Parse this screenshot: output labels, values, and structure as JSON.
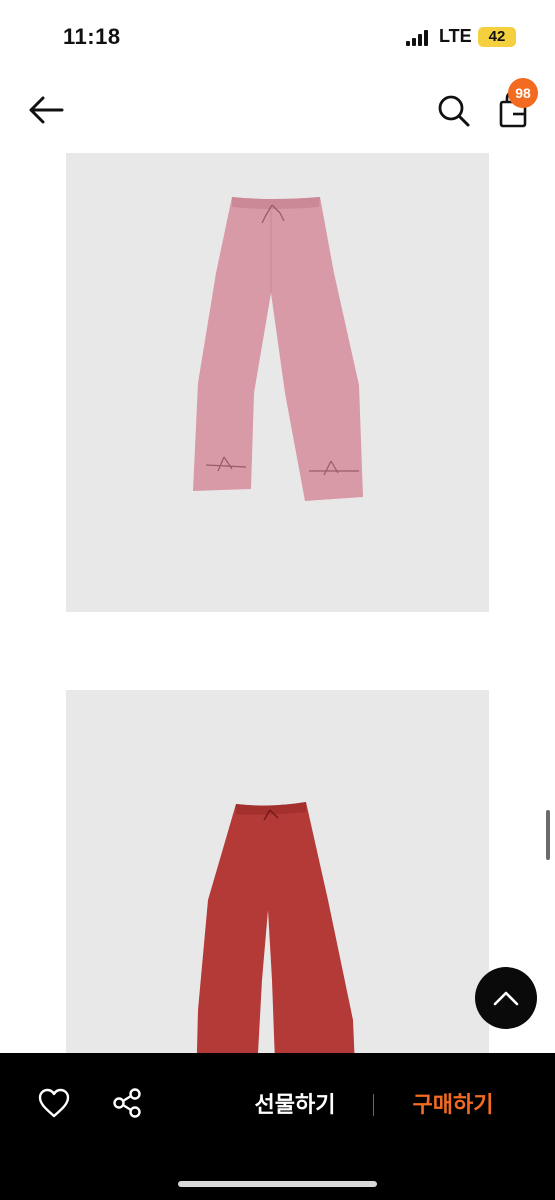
{
  "status_bar": {
    "time": "11:18",
    "network": "LTE",
    "battery": "42"
  },
  "nav": {
    "back_icon": "arrow-left-icon",
    "search_icon": "search-icon",
    "cart_icon": "shopping-bag-icon",
    "cart_count": "98"
  },
  "product_images": [
    {
      "color": "#d89aa6",
      "type": "pants"
    },
    {
      "color": "#b33a36",
      "type": "pants"
    }
  ],
  "scroll_top_icon": "chevron-up-icon",
  "bottom_bar": {
    "like_icon": "heart-icon",
    "share_icon": "share-icon",
    "gift_label": "선물하기",
    "buy_label": "구매하기"
  },
  "colors": {
    "accent": "#f26b21",
    "image_background": "#e8e8e9",
    "bottom_bar": "#000000"
  }
}
